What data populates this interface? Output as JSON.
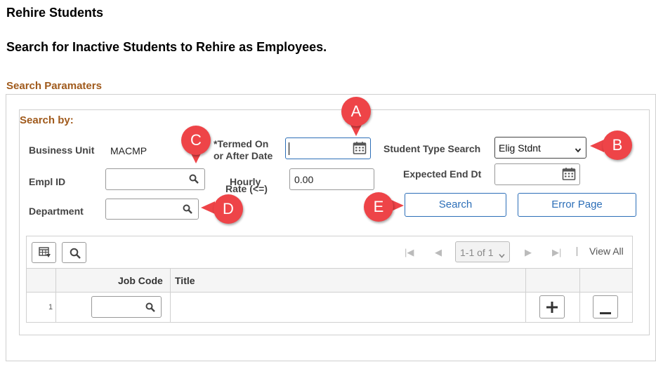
{
  "page": {
    "title": "Rehire Students",
    "subtitle": "Search for Inactive Students to Rehire as Employees."
  },
  "section": {
    "title": "Search Paramaters",
    "group_label": "Search by:"
  },
  "fields": {
    "business_unit_label": "Business Unit",
    "business_unit_value": "MACMP",
    "empl_id_label": "Empl ID",
    "empl_id_value": "",
    "department_label": "Department",
    "department_value": "",
    "termed_on_label_line1": "*Termed On",
    "termed_on_label_line2": "or After Date",
    "termed_on_value": "",
    "hourly_rate_label_line1": "Hourly",
    "hourly_rate_label_line2": "Rate (<=)",
    "hourly_rate_value": "0.00",
    "student_type_label": "Student Type Search",
    "student_type_value": "Elig Stdnt",
    "expected_end_label": "Expected End Dt",
    "expected_end_value": ""
  },
  "buttons": {
    "search": "Search",
    "error_page": "Error Page"
  },
  "grid": {
    "pager_label": "1-1 of 1",
    "view_all": "View All",
    "columns": [
      "Job Code",
      "Title"
    ],
    "rows": [
      {
        "num": "1",
        "job_code": "",
        "title": ""
      }
    ]
  },
  "callouts": [
    "A",
    "B",
    "C",
    "D",
    "E"
  ],
  "colors": {
    "accent_brown": "#a05a1c",
    "link_blue": "#2d6fb8",
    "callout_red": "#ee4448"
  }
}
